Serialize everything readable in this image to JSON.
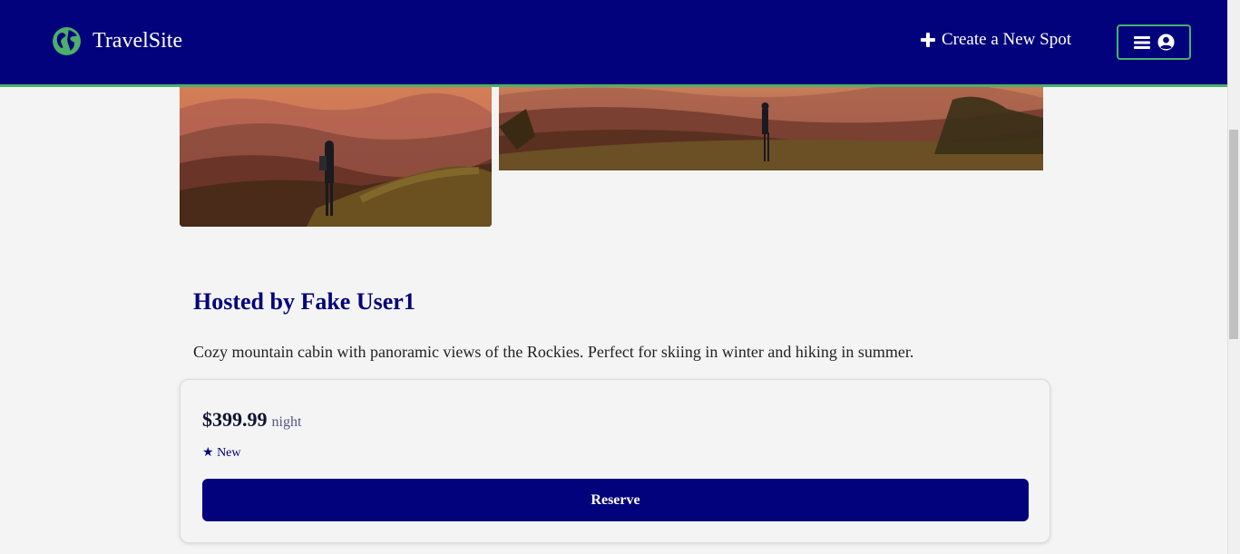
{
  "header": {
    "site_name": "TravelSite",
    "create_spot_label": "Create a New Spot",
    "logo_icon": "globe-icon",
    "menu_icons": [
      "hamburger-icon",
      "user-circle-icon"
    ]
  },
  "colors": {
    "brand_navy": "#02027c",
    "accent_green": "#4caf6a",
    "background": "#f4f4f4"
  },
  "spot": {
    "host_title": "Hosted by Fake User1",
    "description": "Cozy mountain cabin with panoramic views of the Rockies. Perfect for skiing in winter and hiking in summer."
  },
  "booking": {
    "price": "$399.99",
    "per": "night",
    "rating_star": "★",
    "rating_text": "New",
    "reserve_label": "Reserve"
  }
}
